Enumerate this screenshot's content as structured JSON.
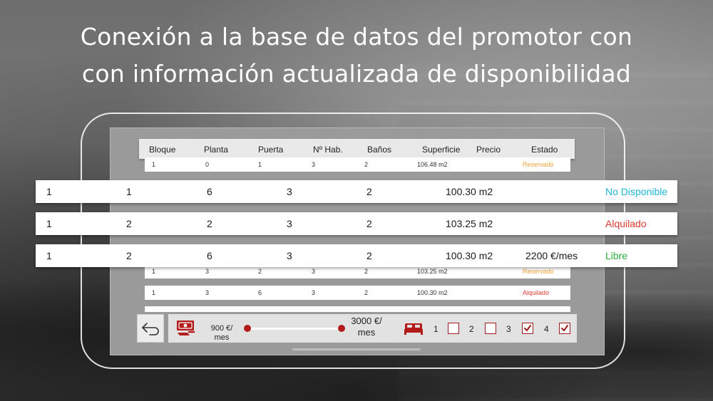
{
  "headline": {
    "line1": "Conexión a la base de datos del promotor con",
    "line2": "con información actualizada de disponibilidad"
  },
  "table": {
    "headers": [
      "Bloque",
      "Planta",
      "Puerta",
      "Nº Hab.",
      "Baños",
      "Superficie",
      "Precio",
      "Estado"
    ],
    "background_rows": [
      {
        "bloque": "1",
        "planta": "0",
        "puerta": "1",
        "hab": "3",
        "banos": "2",
        "superficie": "106.48 m2",
        "precio": "",
        "estado": "Reservado",
        "status": "orange"
      },
      {
        "bloque": "1",
        "planta": "3",
        "puerta": "2",
        "hab": "3",
        "banos": "2",
        "superficie": "103.25 m2",
        "precio": "",
        "estado": "Reservado",
        "status": "orange"
      },
      {
        "bloque": "1",
        "planta": "3",
        "puerta": "6",
        "hab": "3",
        "banos": "2",
        "superficie": "100.30 m2",
        "precio": "",
        "estado": "Alquilado",
        "status": "red"
      }
    ],
    "highlight_rows": [
      {
        "bloque": "1",
        "planta": "1",
        "puerta": "6",
        "hab": "3",
        "banos": "2",
        "superficie": "100.30 m2",
        "precio": "",
        "estado": "No Disponible",
        "status": "cyan"
      },
      {
        "bloque": "1",
        "planta": "2",
        "puerta": "2",
        "hab": "3",
        "banos": "2",
        "superficie": "103.25 m2",
        "precio": "",
        "estado": "Alquilado",
        "status": "red"
      },
      {
        "bloque": "1",
        "planta": "2",
        "puerta": "6",
        "hab": "3",
        "banos": "2",
        "superficie": "100.30 m2",
        "precio": "2200 €/mes",
        "estado": "Libre",
        "status": "green"
      }
    ]
  },
  "filters": {
    "back_icon": "back-arrow-icon",
    "price_icon": "money-icon",
    "price_min_line1": "900 €/",
    "price_min_line2": "mes",
    "price_max_line1": "3000 €/",
    "price_max_line2": "mes",
    "rooms_icon": "bed-icon",
    "rooms": [
      {
        "label": "1",
        "checked": false
      },
      {
        "label": "2",
        "checked": false
      },
      {
        "label": "3",
        "checked": true
      },
      {
        "label": "4",
        "checked": true
      }
    ]
  },
  "colors": {
    "accent": "#b31b1b",
    "reservado": "#f0a23a",
    "alquilado": "#e03a2f",
    "no_disponible": "#1fb5d4",
    "libre": "#2eae3a"
  }
}
